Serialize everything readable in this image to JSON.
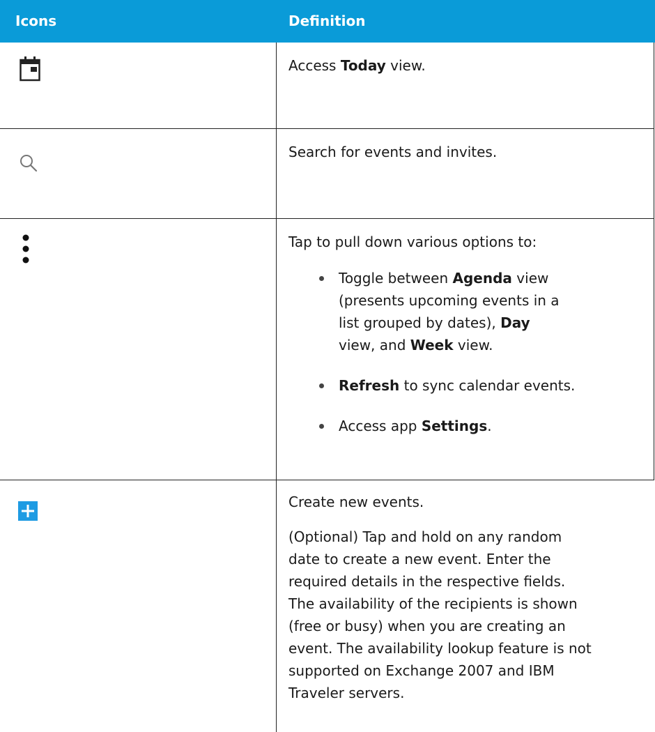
{
  "header": {
    "col1": "Icons",
    "col2": "Definition"
  },
  "rows": [
    {
      "icon": "calendar-today-icon",
      "pre": "Access ",
      "bold": "Today",
      "post": " view."
    },
    {
      "icon": "search-icon",
      "text": "Search for events and invites."
    },
    {
      "icon": "more-vertical-icon",
      "intro": "Tap to pull down various options to:",
      "bullets": [
        {
          "a": "Toggle between ",
          "b1": "Agenda",
          "c": " view",
          "d": "(presents upcoming events in a",
          "e": "list grouped by dates), ",
          "b2": "Day",
          "f": "view, and ",
          "b3": "Week",
          "g": " view."
        },
        {
          "b": "Refresh",
          "a": " to sync calendar events."
        },
        {
          "a": "Access app ",
          "b": "Settings",
          "c": "."
        }
      ]
    },
    {
      "icon": "plus-icon",
      "line1": "Create new events.",
      "para": [
        "(Optional) Tap and hold on any random",
        "date to create a new event. Enter the",
        "required details in the respective fields.",
        "The availability of the recipients is shown",
        "(free or busy) when you are creating an",
        "event. The availability lookup feature is not",
        "supported on Exchange 2007 and IBM",
        "Traveler servers."
      ]
    }
  ],
  "colors": {
    "header_bg": "#0a9bd8",
    "plus_icon_bg": "#1e9be3"
  }
}
